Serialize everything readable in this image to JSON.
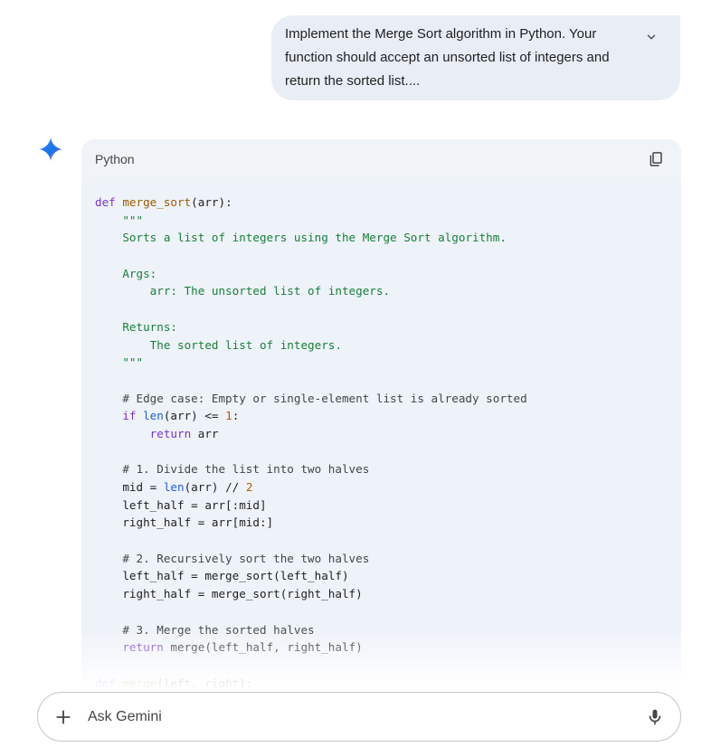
{
  "user_message": {
    "lines": [
      "Implement the Merge Sort algorithm in Python. Your",
      "function should accept an unsorted list of integers and",
      "return the sorted list...."
    ],
    "expand_icon": "chevron-down-icon"
  },
  "assistant": {
    "logo_icon": "gemini-sparkle-icon",
    "logo_colors": [
      "#4285f4",
      "#1a73e8",
      "#9b72cb"
    ]
  },
  "code_block": {
    "language": "Python",
    "copy_icon": "copy-icon",
    "lines": [
      [
        {
          "t": "def ",
          "c": "kw"
        },
        {
          "t": "merge_sort",
          "c": "fn"
        },
        {
          "t": "(arr):",
          "c": ""
        }
      ],
      [
        {
          "t": "    \"\"\"",
          "c": "str"
        }
      ],
      [
        {
          "t": "    Sorts a list of integers using the Merge Sort algorithm.",
          "c": "str"
        }
      ],
      [
        {
          "t": "",
          "c": ""
        }
      ],
      [
        {
          "t": "    Args:",
          "c": "str"
        }
      ],
      [
        {
          "t": "        arr: The unsorted list of integers.",
          "c": "str"
        }
      ],
      [
        {
          "t": "",
          "c": ""
        }
      ],
      [
        {
          "t": "    Returns:",
          "c": "str"
        }
      ],
      [
        {
          "t": "        The sorted list of integers.",
          "c": "str"
        }
      ],
      [
        {
          "t": "    \"\"\"",
          "c": "str"
        }
      ],
      [
        {
          "t": "",
          "c": ""
        }
      ],
      [
        {
          "t": "    # Edge case: Empty or single-element list is already sorted",
          "c": "cm"
        }
      ],
      [
        {
          "t": "    ",
          "c": ""
        },
        {
          "t": "if ",
          "c": "kw"
        },
        {
          "t": "len",
          "c": "bi"
        },
        {
          "t": "(arr) <= ",
          "c": ""
        },
        {
          "t": "1",
          "c": "num"
        },
        {
          "t": ":",
          "c": ""
        }
      ],
      [
        {
          "t": "        ",
          "c": ""
        },
        {
          "t": "return ",
          "c": "kw"
        },
        {
          "t": "arr",
          "c": ""
        }
      ],
      [
        {
          "t": "",
          "c": ""
        }
      ],
      [
        {
          "t": "    # 1. Divide the list into two halves",
          "c": "cm"
        }
      ],
      [
        {
          "t": "    mid = ",
          "c": ""
        },
        {
          "t": "len",
          "c": "bi"
        },
        {
          "t": "(arr) // ",
          "c": ""
        },
        {
          "t": "2",
          "c": "num"
        }
      ],
      [
        {
          "t": "    left_half = arr[:mid]",
          "c": ""
        }
      ],
      [
        {
          "t": "    right_half = arr[mid:]",
          "c": ""
        }
      ],
      [
        {
          "t": "",
          "c": ""
        }
      ],
      [
        {
          "t": "    # 2. Recursively sort the two halves",
          "c": "cm"
        }
      ],
      [
        {
          "t": "    left_half = merge_sort(left_half)",
          "c": ""
        }
      ],
      [
        {
          "t": "    right_half = merge_sort(right_half)",
          "c": ""
        }
      ],
      [
        {
          "t": "",
          "c": ""
        }
      ],
      [
        {
          "t": "    # 3. Merge the sorted halves",
          "c": "cm"
        }
      ],
      [
        {
          "t": "    ",
          "c": ""
        },
        {
          "t": "return ",
          "c": "kw"
        },
        {
          "t": "merge(left_half, right_half)",
          "c": ""
        }
      ],
      [
        {
          "t": "",
          "c": ""
        }
      ],
      [
        {
          "t": "def ",
          "c": "kw"
        },
        {
          "t": "merge",
          "c": "fn"
        },
        {
          "t": "(left, right):",
          "c": ""
        }
      ]
    ]
  },
  "input_bar": {
    "placeholder": "Ask Gemini",
    "value": "",
    "plus_icon": "plus-icon",
    "mic_icon": "microphone-icon"
  },
  "colors": {
    "bubble_bg": "#e9eef6",
    "code_bg": "#eef2f9",
    "keyword": "#7b36c9",
    "function": "#9a5c00",
    "string": "#188038",
    "comment": "#444746",
    "builtin": "#1a62d6",
    "number": "#b55d00"
  }
}
